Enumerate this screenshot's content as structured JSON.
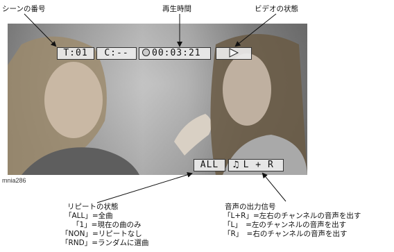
{
  "labels": {
    "scene_number": "シーンの番号",
    "playback_time": "再生時間",
    "video_status": "ビデオの状態"
  },
  "osd_top": {
    "title": "T:01",
    "chapter": "C:--",
    "time": "00:03:21",
    "status_icon": "play-icon"
  },
  "osd_bottom": {
    "repeat": "ALL",
    "audio": "L + R",
    "audio_icon": "music-note-icon"
  },
  "caption": "mnia286",
  "repeat_legend": {
    "title": "リピートの状態",
    "lines": [
      "「ALL」=全曲",
      "「1」=現在の曲のみ",
      "「NON」=リピートなし",
      "「RND」=ランダムに選曲"
    ]
  },
  "audio_legend": {
    "title": "音声の出力信号",
    "lines": [
      "「L+R」=左右のチャンネルの音声を出す",
      "「L」　=左のチャンネルの音声を出す",
      "「R」　=右のチャンネルの音声を出す"
    ]
  }
}
